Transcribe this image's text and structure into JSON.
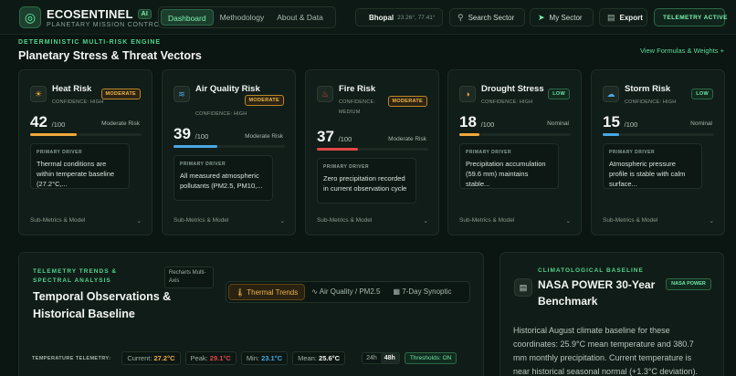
{
  "brand": {
    "name": "ECOSENTINEL",
    "badge": "AI",
    "subtitle": "PLANETARY MISSION CONTROL"
  },
  "nav": {
    "tabs": [
      "Dashboard",
      "Methodology",
      "About & Data"
    ],
    "active": "Dashboard"
  },
  "location": {
    "city": "Bhopal",
    "coords": "23.26°, 77.41°"
  },
  "toolbar": {
    "search_label": "Search Sector",
    "my_sector_label": "My Sector",
    "export_label": "Export",
    "telemetry_label": "TELEMETRY ACTIVE"
  },
  "engine": {
    "label": "DETERMINISTIC MULTI-RISK ENGINE",
    "title": "Planetary Stress & Threat Vectors",
    "view_link": "View Formulas & Weights +"
  },
  "cards": [
    {
      "title": "Heat Risk",
      "confidence": "CONFIDENCE: HIGH",
      "badge": "MODERATE",
      "score": "42",
      "of": "/100",
      "risk_text": "Moderate Risk",
      "progress": 0.42,
      "bar_color": "#f0a93b",
      "driver_label": "PRIMARY DRIVER",
      "driver": "Thermal conditions are within temperate baseline (27.2°C,...",
      "submetrics": "Sub-Metrics & Model",
      "icon": "sun-icon"
    },
    {
      "title": "Air Quality Risk",
      "confidence": "CONFIDENCE: HIGH",
      "badge": "MODERATE",
      "score": "39",
      "of": "/100",
      "risk_text": "Moderate Risk",
      "progress": 0.39,
      "bar_color": "#49a8e4",
      "driver_label": "PRIMARY DRIVER",
      "driver": "All measured atmospheric pollutants (PM2.5, PM10,...",
      "submetrics": "Sub-Metrics & Model",
      "icon": "wind-icon"
    },
    {
      "title": "Fire Risk",
      "confidence": "CONFIDENCE: MEDIUM",
      "badge": "MODERATE",
      "score": "37",
      "of": "/100",
      "risk_text": "Moderate Risk",
      "progress": 0.37,
      "bar_color": "#e04848",
      "driver_label": "PRIMARY DRIVER",
      "driver": "Zero precipitation recorded in current observation cycle",
      "submetrics": "Sub-Metrics & Model",
      "icon": "flame-icon"
    },
    {
      "title": "Drought Stress",
      "confidence": "CONFIDENCE: HIGH",
      "badge": "LOW",
      "score": "18",
      "of": "/100",
      "risk_text": "Nominal",
      "progress": 0.18,
      "bar_color": "#f0a93b",
      "driver_label": "PRIMARY DRIVER",
      "driver": "Precipitation accumulation (59.6 mm) maintains stable...",
      "submetrics": "Sub-Metrics & Model",
      "icon": "drought-icon"
    },
    {
      "title": "Storm Risk",
      "confidence": "CONFIDENCE: HIGH",
      "badge": "LOW",
      "score": "15",
      "of": "/100",
      "risk_text": "Nominal",
      "progress": 0.15,
      "bar_color": "#49a8e4",
      "driver_label": "PRIMARY DRIVER",
      "driver": "Atmospheric pressure profile is stable with calm surface...",
      "submetrics": "Sub-Metrics & Model",
      "icon": "cloud-icon"
    }
  ],
  "trends": {
    "label": "TELEMETRY TRENDS & SPECTRAL ANALYSIS",
    "library": "Recharts Multi-Axis",
    "title": "Temporal Observations & Historical Baseline",
    "tabs": [
      "Thermal Trends",
      "Air Quality / PM2.5",
      "7-Day Synoptic"
    ],
    "active_tab": "Thermal Trends",
    "telemetry_label": "TEMPERATURE TELEMETRY:",
    "stats": [
      {
        "label": "Current:",
        "value": "27.2°C",
        "color": "#f0a93b"
      },
      {
        "label": "Peak:",
        "value": "29.1°C",
        "color": "#e04848"
      },
      {
        "label": "Min:",
        "value": "23.1°C",
        "color": "#49a8e4"
      },
      {
        "label": "Mean:",
        "value": "25.6°C",
        "color": "#f1f5f2"
      }
    ],
    "range_options": [
      "24h",
      "48h"
    ],
    "active_range": "48h",
    "thresholds": "Thresholds: ON"
  },
  "baseline": {
    "label": "CLIMATOLOGICAL BASELINE",
    "title": "NASA POWER 30-Year Benchmark",
    "badge": "NASA POWER",
    "text": "Historical August climate baseline for these coordinates: 25.9°C mean temperature and 380.7 mm monthly precipitation. Current temperature is near historical seasonal normal (+1.3°C deviation)."
  }
}
